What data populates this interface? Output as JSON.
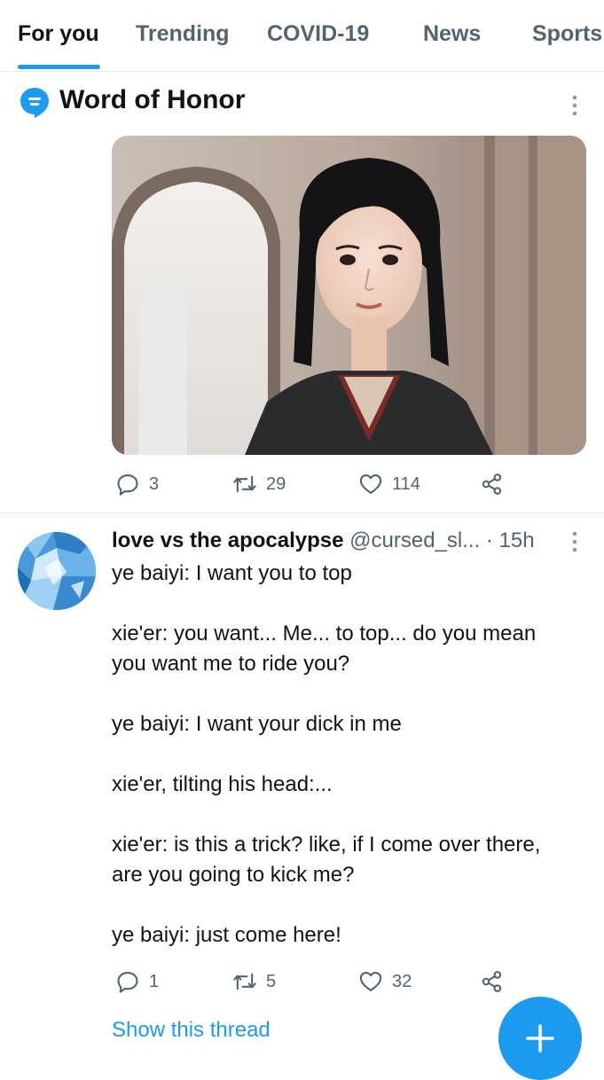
{
  "tabs": [
    {
      "label": "For you"
    },
    {
      "label": "Trending"
    },
    {
      "label": "COVID-19"
    },
    {
      "label": "News"
    },
    {
      "label": "Sports"
    }
  ],
  "topic": {
    "title": "Word of Honor"
  },
  "post1": {
    "replies": "3",
    "retweets": "29",
    "likes": "114"
  },
  "tweet": {
    "name": "love vs the apocalypse",
    "handle": "@cursed_sl...",
    "sep": " · ",
    "time": "15h",
    "lines": [
      "ye baiyi: I want you to top",
      "xie'er: you want... Me... to top... do you mean you want me to ride you?",
      "ye baiyi: I want your dick in me",
      "xie'er, tilting his head:...",
      "xie'er: is this a trick? like, if I come over there, are you going to kick me?",
      "ye baiyi: just come here!"
    ],
    "replies": "1",
    "retweets": "5",
    "likes": "32",
    "show_thread": "Show this thread"
  },
  "colors": {
    "accent": "#1d9bf0",
    "secondary_text": "#536471",
    "divider": "#e6ecf0"
  }
}
